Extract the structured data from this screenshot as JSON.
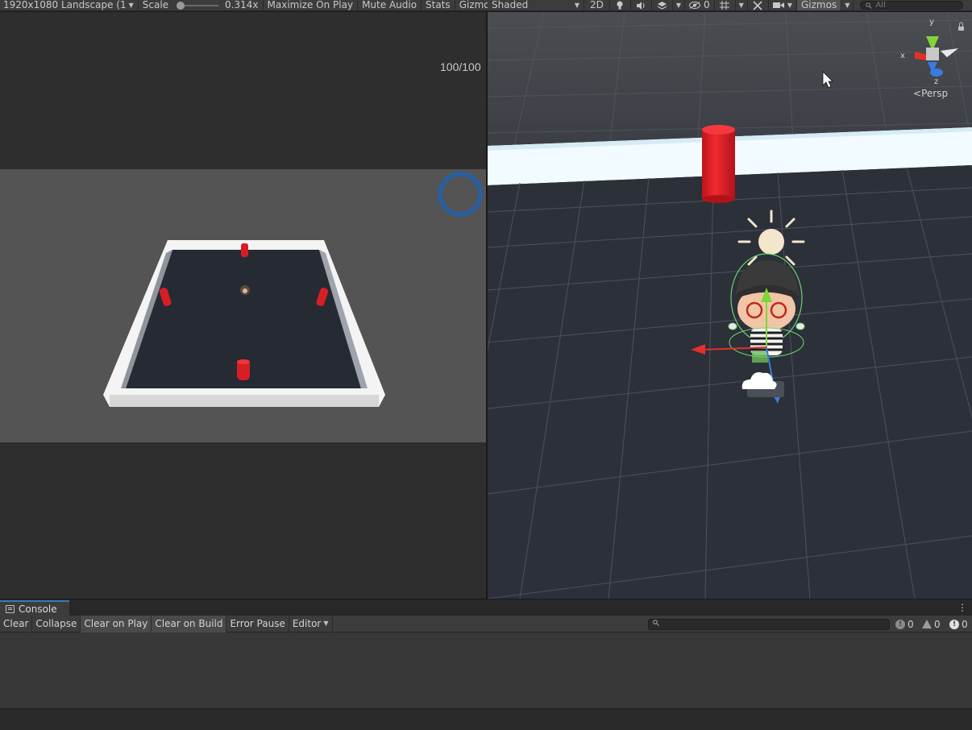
{
  "game_toolbar": {
    "resolution": "1920x1080 Landscape (1",
    "scale_label": "Scale",
    "scale_value": "0.314x",
    "scale_level": 0.0,
    "maximize": "Maximize On Play",
    "mute": "Mute Audio",
    "stats": "Stats",
    "gizmos": "Gizmos"
  },
  "scene_toolbar": {
    "shading_mode": "Shaded",
    "mode_2d": "2D",
    "hidden_count": "0",
    "gizmos": "Gizmos",
    "search_placeholder": "All"
  },
  "game_view": {
    "hp_text": "100/100",
    "hp_ring_color": "#2a5f9e"
  },
  "scene_view": {
    "persp_label": "Persp",
    "axis_x": "x",
    "axis_y": "y",
    "axis_z": "z"
  },
  "console": {
    "tab_label": "Console",
    "buttons": [
      "Clear",
      "Collapse",
      "Clear on Play",
      "Clear on Build",
      "Error Pause",
      "Editor"
    ],
    "active_buttons": [
      "Clear on Play",
      "Clear on Build"
    ],
    "log_count": "0",
    "warning_count": "0",
    "error_count": "0"
  },
  "icons": [
    "search-icon",
    "light-icon",
    "audio-icon",
    "effects-icon",
    "visibility-icon",
    "grid-icon",
    "tools-icon",
    "camera-icon",
    "lock-icon",
    "sun-gizmo-icon",
    "cloud-gizmo-icon",
    "mouse-cursor-icon",
    "more-icon"
  ],
  "colors": {
    "accent": "#3a79bb",
    "cylinder": "#e21f26",
    "scene_floor": "#343842",
    "game_bg": "#545454"
  }
}
